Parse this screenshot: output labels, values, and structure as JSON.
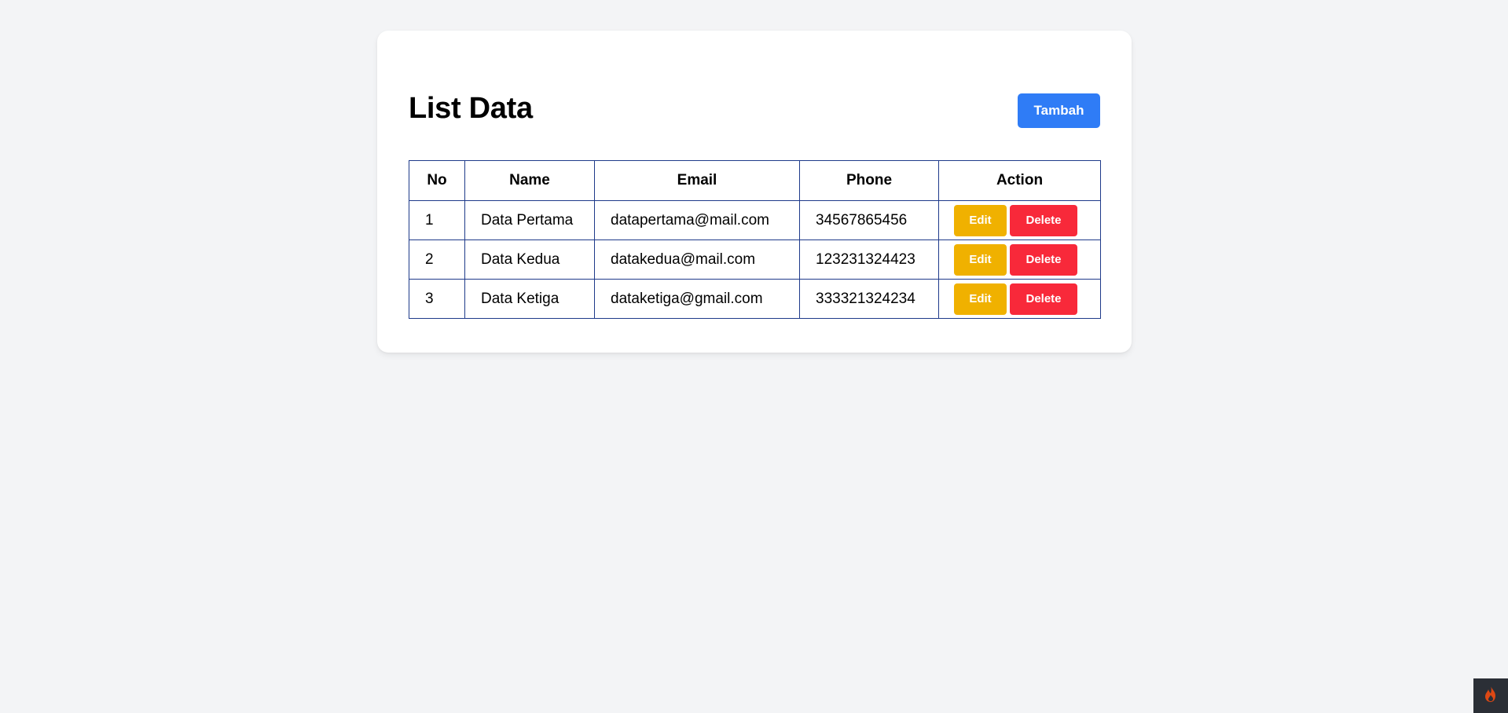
{
  "page": {
    "title": "List Data",
    "add_button_label": "Tambah"
  },
  "table": {
    "headers": [
      "No",
      "Name",
      "Email",
      "Phone",
      "Action"
    ],
    "rows": [
      {
        "no": "1",
        "name": "Data Pertama",
        "email": "datapertama@mail.com",
        "phone": "34567865456",
        "edit_label": "Edit",
        "delete_label": "Delete"
      },
      {
        "no": "2",
        "name": "Data Kedua",
        "email": "datakedua@mail.com",
        "phone": "123231324423",
        "edit_label": "Edit",
        "delete_label": "Delete"
      },
      {
        "no": "3",
        "name": "Data Ketiga",
        "email": "dataketiga@gmail.com",
        "phone": "333321324234",
        "edit_label": "Edit",
        "delete_label": "Delete"
      }
    ]
  },
  "colors": {
    "page_background": "#f3f4f6",
    "card_background": "#ffffff",
    "primary": "#2f7cf6",
    "warning": "#f0b100",
    "danger": "#f8293a",
    "table_border": "#1e3a8a",
    "badge_background": "#2b2f36",
    "badge_flame": "#dd4814"
  },
  "icons": {
    "corner_badge": "flame-icon"
  }
}
